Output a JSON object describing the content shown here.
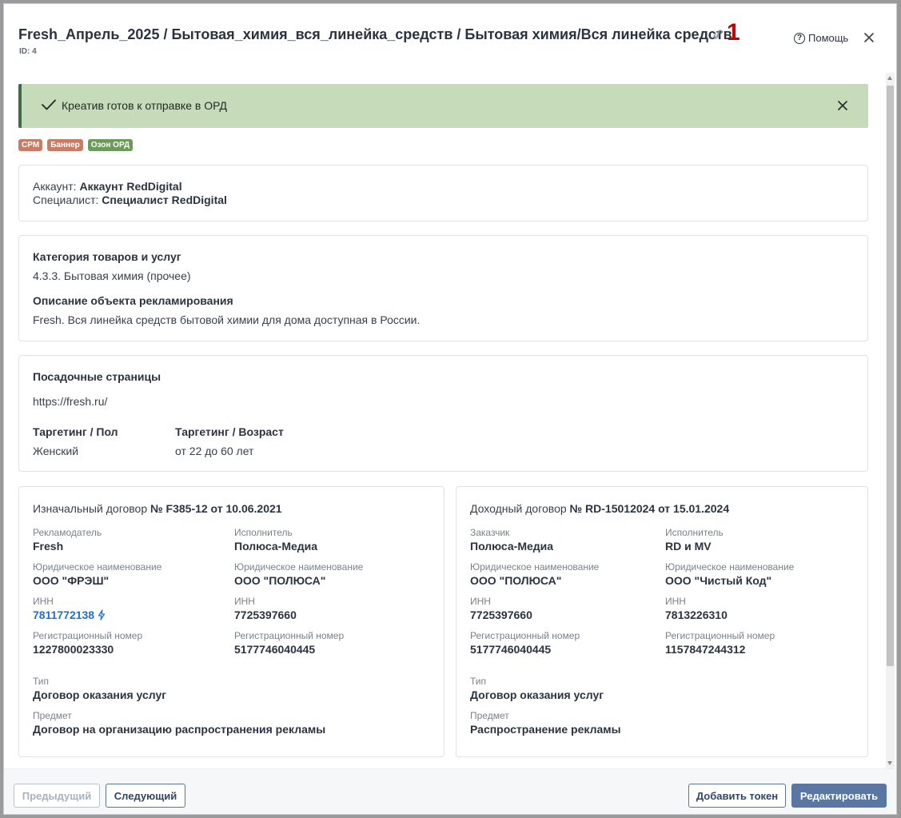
{
  "header": {
    "title": "Fresh_Апрель_2025 / Бытовая_химия_вся_линейка_средств / Бытовая химия/Вся линейка средств",
    "marker": "1",
    "id_label": "ID: 4",
    "help_label": "Помощь",
    "help_glyph": "?"
  },
  "alert": {
    "text": "Креатив готов к отправке в ОРД",
    "color": "#c5dbba"
  },
  "tags": [
    {
      "label": "CPM",
      "color": "#c97b66"
    },
    {
      "label": "Баннер",
      "color": "#c97b66"
    },
    {
      "label": "Озон ОРД",
      "color": "#6b9a5a"
    }
  ],
  "account": {
    "account_label": "Аккаунт:",
    "account_value": "Аккаунт RedDigital",
    "specialist_label": "Специалист:",
    "specialist_value": "Специалист RedDigital"
  },
  "category": {
    "title": "Категория товаров и услуг",
    "value": "4.3.3. Бытовая химия (прочее)",
    "description_title": "Описание объекта рекламирования",
    "description_value": "Fresh. Вся линейка средств бытовой химии для дома доступная в России."
  },
  "landing": {
    "title": "Посадочные страницы",
    "url": "https://fresh.ru/",
    "gender_title": "Таргетинг / Пол",
    "gender_value": "Женский",
    "age_title": "Таргетинг / Возраст",
    "age_value": "от 22 до 60 лет"
  },
  "initial_contract": {
    "heading_label": "Изначальный договор",
    "heading_value": "№ F385-12 от 10.06.2021",
    "advertiser_label": "Рекламодатель",
    "advertiser_value": "Fresh",
    "executor_label": "Исполнитель",
    "executor_value": "Полюса-Медиа",
    "legal_label_left": "Юридическое наименование",
    "legal_value_left": "ООО \"ФРЭШ\"",
    "legal_label_right": "Юридическое наименование",
    "legal_value_right": "ООО \"ПОЛЮСА\"",
    "inn_label_left": "ИНН",
    "inn_value_left": "7811772138",
    "inn_label_right": "ИНН",
    "inn_value_right": "7725397660",
    "reg_label_left": "Регистрационный номер",
    "reg_value_left": "1227800023330",
    "reg_label_right": "Регистрационный номер",
    "reg_value_right": "5177746040445",
    "type_label": "Тип",
    "type_value": "Договор оказания услуг",
    "subject_label": "Предмет",
    "subject_value": "Договор на организацию распространения рекламы"
  },
  "income_contract": {
    "heading_label": "Доходный договор",
    "heading_value": "№ RD-15012024 от 15.01.2024",
    "customer_label": "Заказчик",
    "customer_value": "Полюса-Медиа",
    "executor_label": "Исполнитель",
    "executor_value": "RD и MV",
    "legal_label_left": "Юридическое наименование",
    "legal_value_left": "ООО \"ПОЛЮСА\"",
    "legal_label_right": "Юридическое наименование",
    "legal_value_right": "ООО \"Чистый Код\"",
    "inn_label_left": "ИНН",
    "inn_value_left": "7725397660",
    "inn_label_right": "ИНН",
    "inn_value_right": "7813226310",
    "reg_label_left": "Регистрационный номер",
    "reg_value_left": "5177746040445",
    "reg_label_right": "Регистрационный номер",
    "reg_value_right": "1157847244312",
    "type_label": "Тип",
    "type_value": "Договор оказания услуг",
    "subject_label": "Предмет",
    "subject_value": "Распространение рекламы"
  },
  "footer": {
    "prev_label": "Предыдущий",
    "next_label": "Следующий",
    "add_token_label": "Добавить токен",
    "edit_label": "Редактировать"
  },
  "colors": {
    "primary": "#5a77a3",
    "link": "#1f6fd1",
    "alert_border": "#3f6d43"
  }
}
